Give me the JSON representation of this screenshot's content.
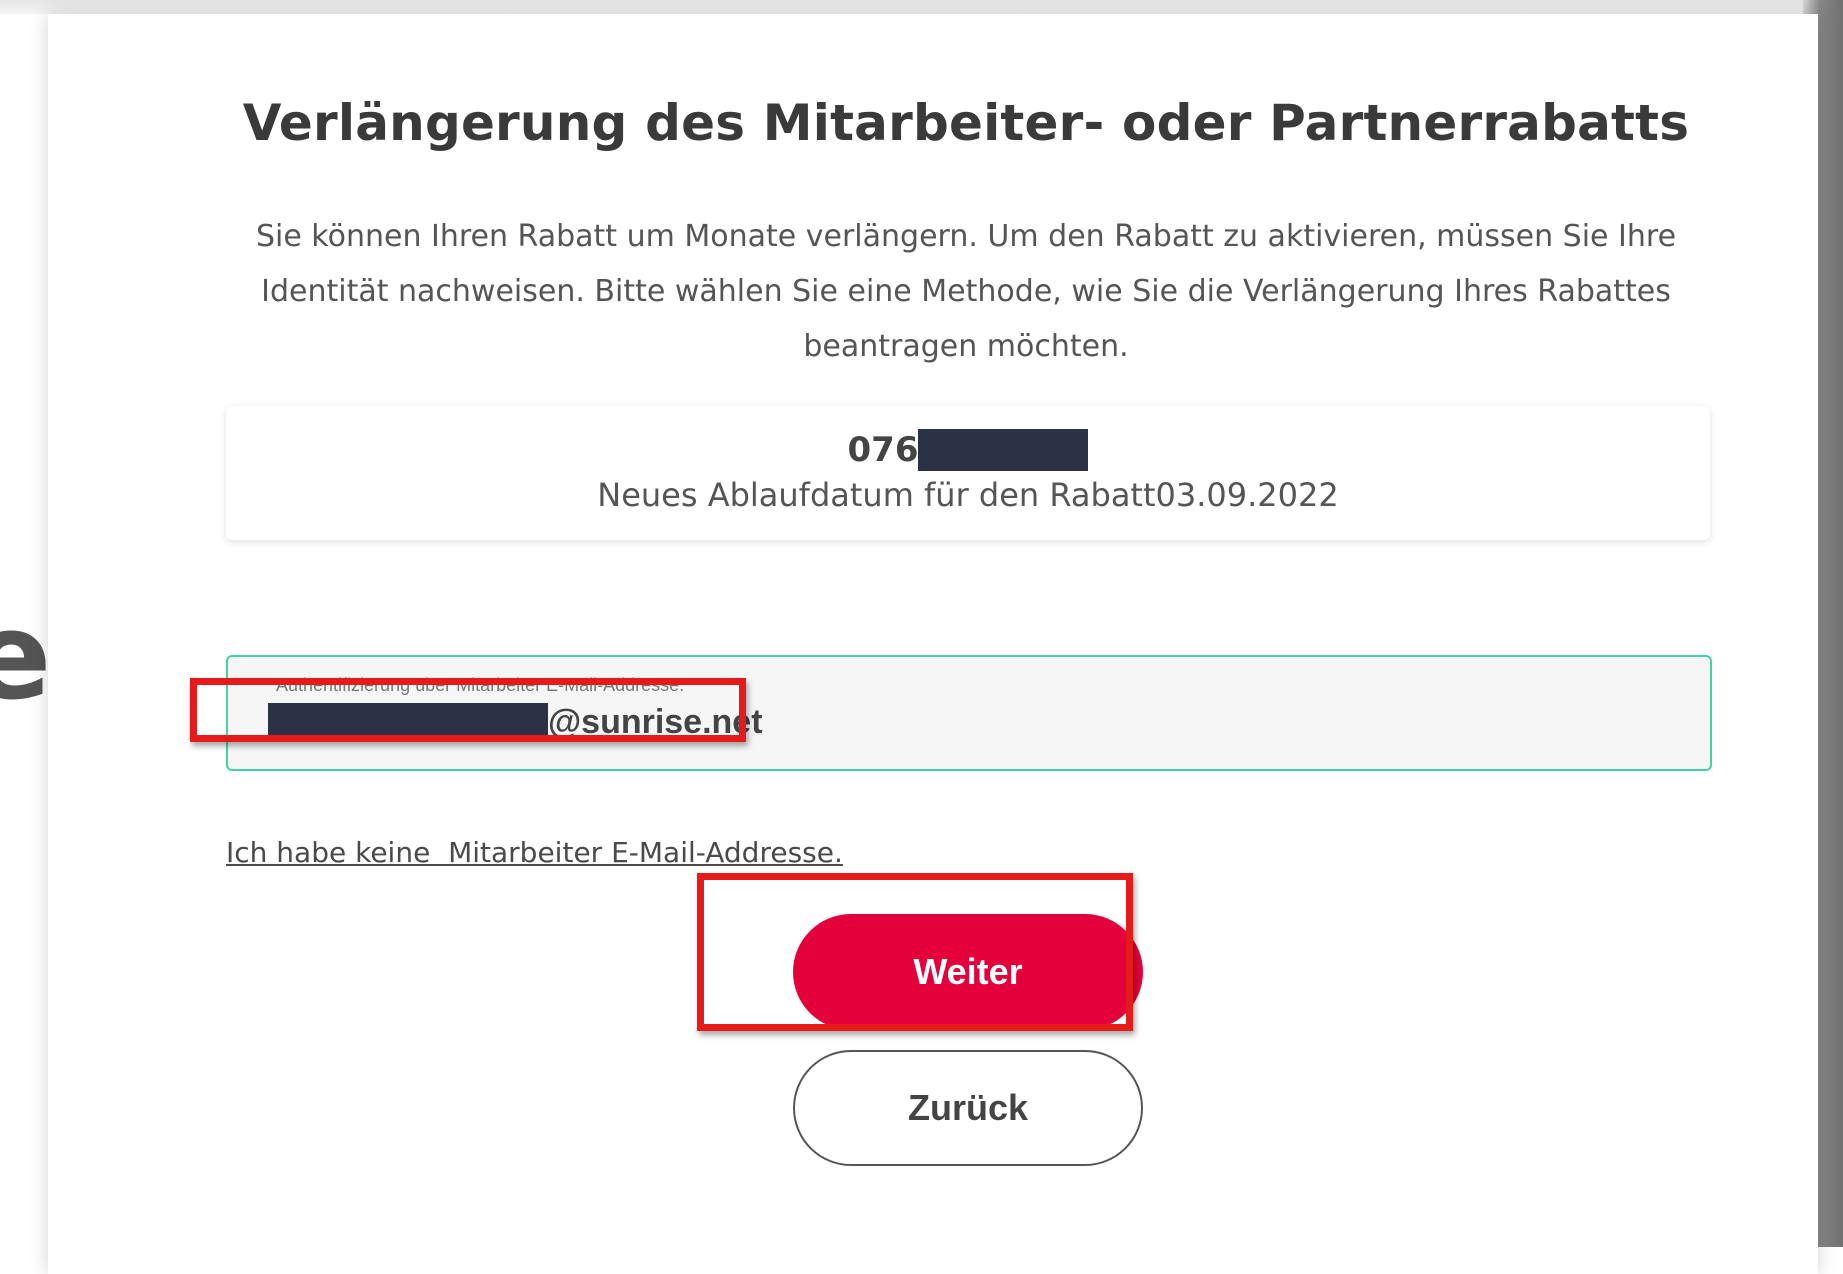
{
  "page": {
    "title": "Verlängerung des Mitarbeiter- oder Partnerrabatts",
    "intro": "Sie können Ihren Rabatt um Monate verlängern. Um den Rabatt zu aktivieren, müssen Sie Ihre Identität nachweisen. Bitte wählen Sie eine Methode, wie Sie die Verlängerung Ihres Rabattes beantragen möchten.",
    "edge_letter": "e"
  },
  "info": {
    "phone_prefix": "076",
    "expiry_text": "Neues Ablaufdatum für den Rabatt03.09.2022"
  },
  "email_field": {
    "label": "Authentifizierung über Mitarbeiter E-Mail-Addresse.",
    "value_domain": "@sunrise.net"
  },
  "links": {
    "no_email": "Ich habe keine  Mitarbeiter E-Mail-Addresse."
  },
  "buttons": {
    "next": "Weiter",
    "back": "Zurück"
  },
  "colors": {
    "primary": "#e4003a",
    "field_border": "#42d4a8",
    "highlight": "#e51b1b",
    "redaction": "#2b3245"
  }
}
